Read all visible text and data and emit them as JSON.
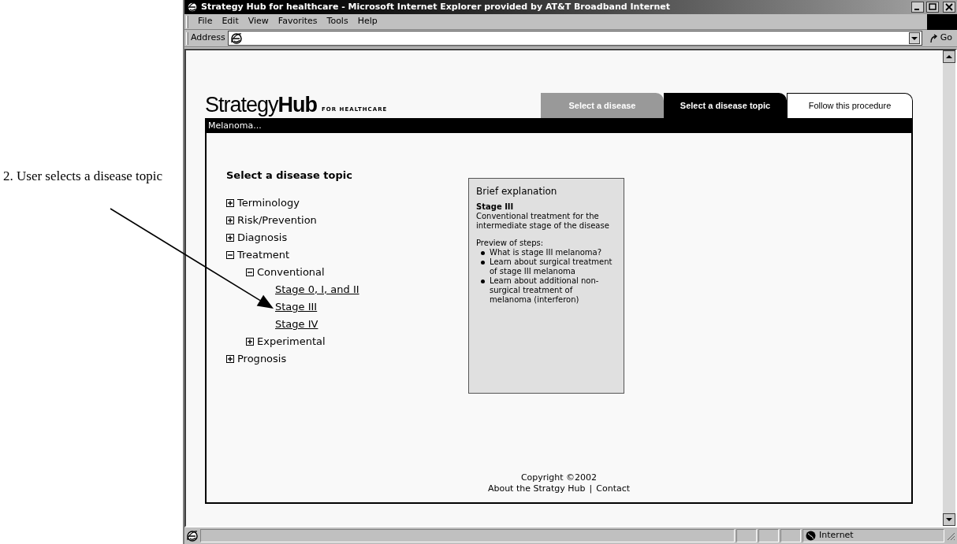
{
  "annotation": {
    "text": "2. User selects a disease topic"
  },
  "window": {
    "title": "Strategy Hub for healthcare - Microsoft Internet Explorer provided by AT&T Broadband Internet"
  },
  "menu": [
    "File",
    "Edit",
    "View",
    "Favorites",
    "Tools",
    "Help"
  ],
  "address_bar": {
    "label": "Address",
    "go_button": "Go"
  },
  "page": {
    "logo": {
      "light": "Strategy",
      "bold": "Hub",
      "tagline": "FOR HEALTHCARE"
    },
    "tabs": [
      {
        "label": "Select a disease",
        "selected": false,
        "visited": true
      },
      {
        "label": "Select a disease topic",
        "selected": true,
        "visited": true
      },
      {
        "label": "Follow this procedure",
        "selected": false,
        "visited": false
      }
    ],
    "breadcrumb": "Melanoma...",
    "heading": "Select a disease topic",
    "tree": [
      {
        "label": "Terminology",
        "kind": "folder",
        "expanded": false
      },
      {
        "label": "Risk/Prevention",
        "kind": "folder",
        "expanded": false
      },
      {
        "label": "Diagnosis",
        "kind": "folder",
        "expanded": false
      },
      {
        "label": "Treatment",
        "kind": "folder",
        "expanded": true,
        "children": [
          {
            "label": "Conventional",
            "kind": "folder",
            "expanded": true,
            "children": [
              {
                "label": "Stage 0, I, and II",
                "kind": "link"
              },
              {
                "label": "Stage III",
                "kind": "link"
              },
              {
                "label": "Stage IV",
                "kind": "link"
              }
            ]
          },
          {
            "label": "Experimental",
            "kind": "folder",
            "expanded": false
          }
        ]
      },
      {
        "label": "Prognosis",
        "kind": "folder",
        "expanded": false
      }
    ],
    "explanation": {
      "title": "Brief explanation",
      "subject": "Stage III",
      "summary": "Conventional treatment for the intermediate stage of the disease",
      "steps_label": "Preview of steps:",
      "steps": [
        "What is stage III melanoma?",
        "Learn about surgical treatment of stage III melanoma",
        "Learn about additional non-surgical treatment of melanoma (interferon)"
      ]
    },
    "footer": {
      "copyright": "Copyright ©2002",
      "links": [
        "About the Stratgy Hub",
        "Contact"
      ],
      "separator": "|"
    }
  },
  "status_bar": {
    "zone": "Internet"
  }
}
